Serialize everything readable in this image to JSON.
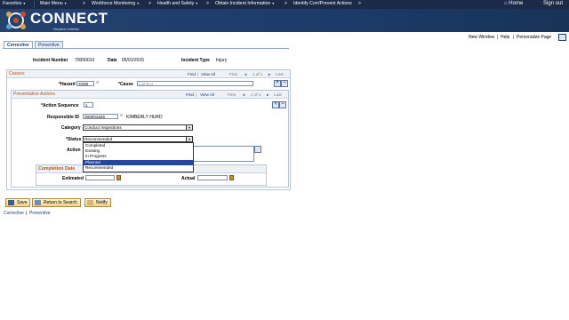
{
  "menubar": {
    "favorites": "Favorites",
    "main_menu": "Main Menu",
    "workforce_monitoring": "Workforce Monitoring",
    "health_and_safety": "Health and Safety",
    "obtain_incident_info": "Obtain Incident Information",
    "identify_corr": "Identify Corr/Prevent Actions",
    "home": "Home",
    "sign_out": "Sign out",
    "separator": ">"
  },
  "banner": {
    "logo": "CONNECT",
    "subtitle": "Maryland Judiciary"
  },
  "util_links": {
    "new_window": "New Window",
    "help": "Help",
    "personalize": "Personalize Page",
    "sep": "|"
  },
  "tabs": [
    "Corrective",
    "Preventive"
  ],
  "header": {
    "incident_number_label": "Incident Number",
    "incident_number": "70000010",
    "date_label": "Date",
    "date": "05/01/2015",
    "incident_type_label": "Incident Type",
    "incident_type": "Injury"
  },
  "causes": {
    "title": "Causes",
    "find": "Find",
    "view_all": "View All",
    "first": "First",
    "range": "1 of 1",
    "last": "Last",
    "hazard_label": "*Hazard",
    "hazard_value": "XS90",
    "cause_label": "*Cause",
    "cause_value": "Lighting"
  },
  "preventative": {
    "title": "Preventative Actions",
    "find": "Find",
    "view_all": "View All",
    "first": "First",
    "range": "1 of 1",
    "last": "Last",
    "action_seq_label": "*Action Sequence",
    "action_seq_value": "1",
    "responsible_label": "Responsible ID",
    "responsible_value": "000001825",
    "responsible_name": "KIMBERLY HURD",
    "category_label": "Category",
    "category_value": "Conduct Inspections",
    "status_label": "*Status",
    "status_value": "Recommended",
    "status_options": [
      "Completed",
      "Existing",
      "In Progress",
      "Planned",
      "Recommended"
    ],
    "status_highlighted": "Planned",
    "action_label": "Action"
  },
  "completion": {
    "title": "Completion Date",
    "estimated_label": "Estimated",
    "actual_label": "Actual"
  },
  "buttons": {
    "save": "Save",
    "return_to_search": "Return to Search",
    "notify": "Notify"
  },
  "footer_links": {
    "corrective": "Corrective",
    "sep": "|",
    "preventive": "Preventive"
  },
  "colors": {
    "menubar": "#1b2a47",
    "banner": "#1c3b68",
    "section_title": "#b2561c",
    "link": "#1b3b71",
    "dropdown_highlight": "#25469b"
  }
}
